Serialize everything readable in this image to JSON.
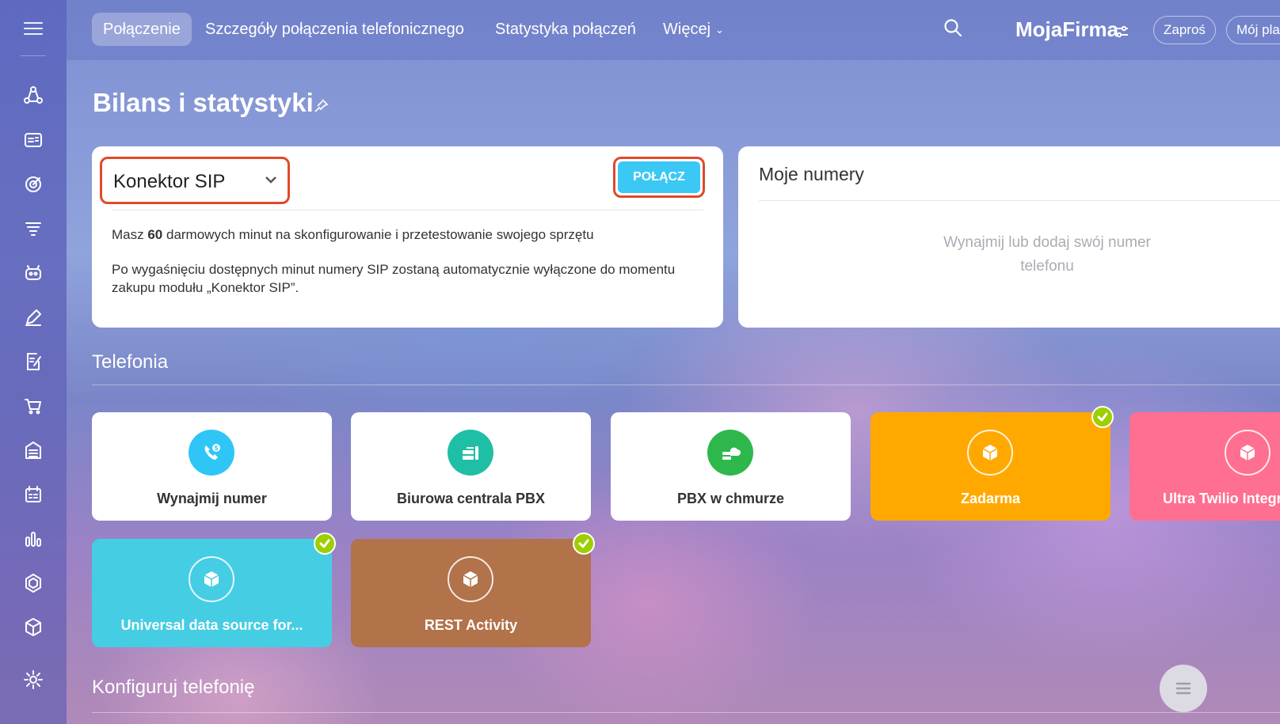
{
  "nav_tabs": [
    {
      "label": "Połączenie",
      "active": true
    },
    {
      "label": "Szczegóły połączenia telefonicznego",
      "active": false
    },
    {
      "label": "Statystyka połączeń",
      "active": false
    },
    {
      "label": "Więcej",
      "active": false
    }
  ],
  "header": {
    "brand": "MojaFirma",
    "invite_label": "Zaproś",
    "plan_label": "Mój plan"
  },
  "page": {
    "title": "Bilans i statystyki"
  },
  "connection_card": {
    "selected_connector": "Konektor SIP",
    "connect_button": "POŁĄCZ",
    "free_minutes_prefix": "Masz ",
    "free_minutes_count": "60",
    "free_minutes_suffix": " darmowych minut na skonfigurowanie i przetestowanie swojego sprzętu",
    "expiry_note": "Po wygaśnięciu dostępnych minut numery SIP zostaną automatycznie wyłączone do momentu zakupu modułu „Konektor SIP”."
  },
  "numbers_card": {
    "title": "Moje numery",
    "empty_text": "Wynajmij lub dodaj swój numer telefonu"
  },
  "telephony": {
    "section_title": "Telefonia",
    "tiles": [
      {
        "label": "Wynajmij numer",
        "icon": "phone-coin-icon",
        "style": "white",
        "icon_color": "#2fc6f6",
        "installed": false
      },
      {
        "label": "Biurowa centrala PBX",
        "icon": "server-icon",
        "style": "white",
        "icon_color": "#1fbfa6",
        "installed": false
      },
      {
        "label": "PBX w chmurze",
        "icon": "cloud-server-icon",
        "style": "white",
        "icon_color": "#2eb84b",
        "installed": false
      },
      {
        "label": "Zadarma",
        "icon": "box-icon",
        "style": "colored",
        "bg_color": "#ffa900",
        "installed": true
      },
      {
        "label": "Ultra Twilio Integration",
        "icon": "box-icon",
        "style": "colored",
        "bg_color": "#ff6f91",
        "installed": false
      },
      {
        "label": "Universal data source for...",
        "icon": "box-icon",
        "style": "colored",
        "bg_color": "#45cde3",
        "installed": true
      },
      {
        "label": "REST Activity",
        "icon": "box-icon",
        "style": "colored",
        "bg_color": "#b2724a",
        "installed": true
      }
    ]
  },
  "configure": {
    "section_title": "Konfiguruj telefonię"
  },
  "colors": {
    "accent": "#3bc8f5",
    "highlight": "#e0492a",
    "check": "#9dcf00"
  }
}
